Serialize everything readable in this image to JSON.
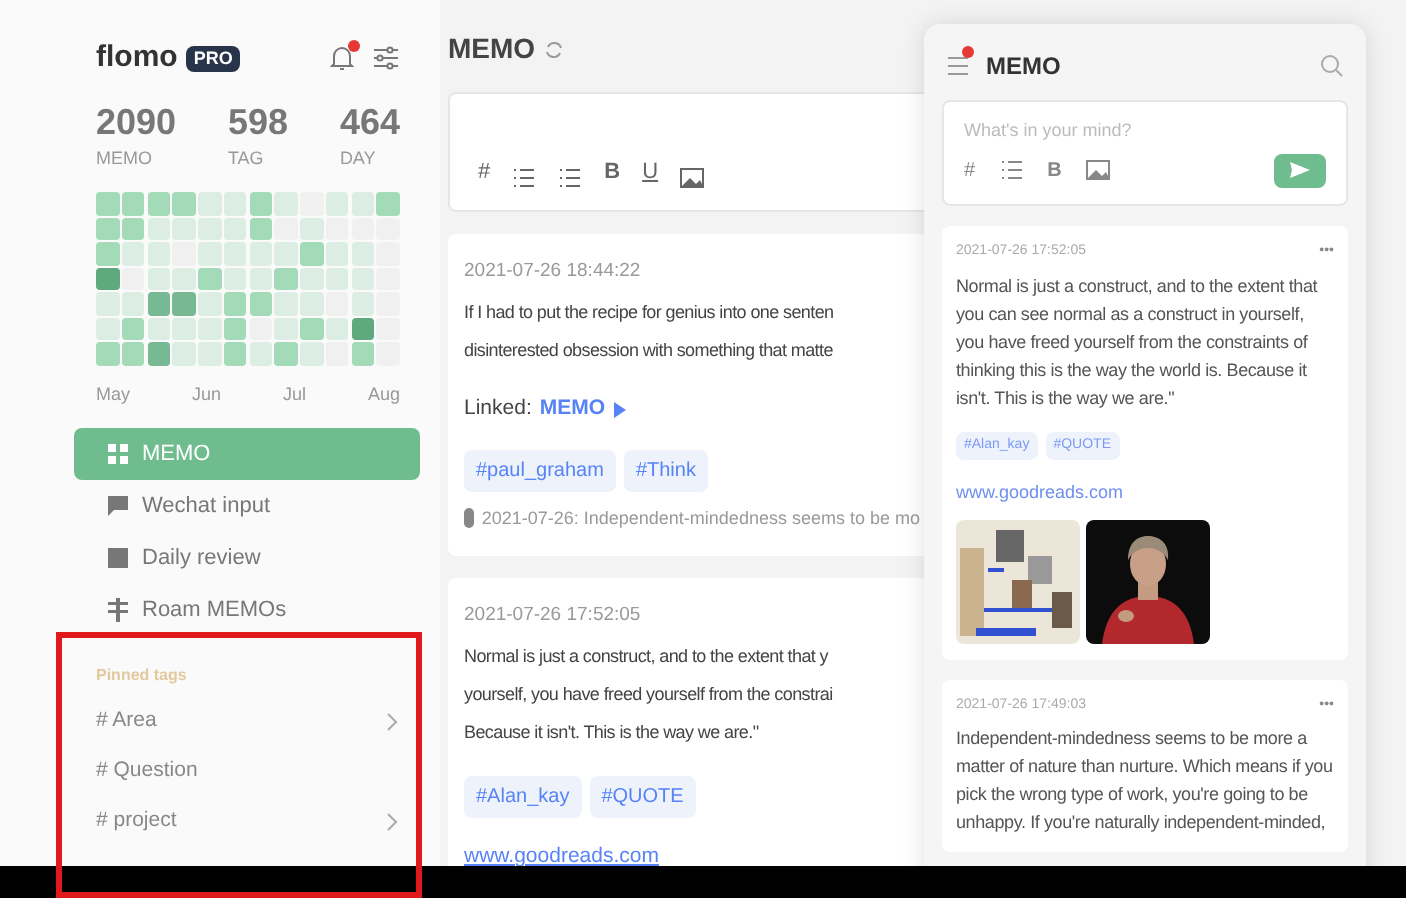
{
  "sidebar": {
    "logo": "flomo",
    "badge": "PRO",
    "notification_dot": true,
    "stats": [
      {
        "value": "2090",
        "label": "MEMO"
      },
      {
        "value": "598",
        "label": "TAG"
      },
      {
        "value": "464",
        "label": "DAY"
      }
    ],
    "heatmap": {
      "rows": [
        [
          {
            "color": "#a3dbb8"
          },
          {
            "color": "#a3dbb8"
          },
          {
            "color": "#a3dbb8"
          },
          {
            "color": "#a3dbb8"
          },
          {
            "color": "#dceee3"
          },
          {
            "color": "#dceee3"
          },
          {
            "color": "#a3dbb8"
          },
          {
            "color": "#dceee3"
          },
          {
            "color": "#f0f0f0"
          },
          {
            "color": "#dceee3"
          },
          {
            "color": "#dceee3"
          },
          {
            "color": "#a3dbb8"
          }
        ],
        [
          {
            "color": "#a3dbb8"
          },
          {
            "color": "#a3dbb8"
          },
          {
            "color": "#dceee3"
          },
          {
            "color": "#dceee3"
          },
          {
            "color": "#dceee3"
          },
          {
            "color": "#dceee3"
          },
          {
            "color": "#a3dbb8"
          },
          {
            "color": "#f0f0f0"
          },
          {
            "color": "#dceee3"
          },
          {
            "color": "#f0f0f0"
          },
          {
            "color": "#f0f0f0"
          },
          {
            "color": "#f0f0f0"
          }
        ],
        [
          {
            "color": "#a3dbb8"
          },
          {
            "color": "#dceee3"
          },
          {
            "color": "#dceee3"
          },
          {
            "color": "#f0f0f0"
          },
          {
            "color": "#dceee3"
          },
          {
            "color": "#dceee3"
          },
          {
            "color": "#dceee3"
          },
          {
            "color": "#dceee3"
          },
          {
            "color": "#a3dbb8"
          },
          {
            "color": "#dceee3"
          },
          {
            "color": "#dceee3"
          },
          {
            "color": "#f0f0f0"
          }
        ],
        [
          {
            "color": "#5fa97e"
          },
          {
            "color": "#f0f0f0"
          },
          {
            "color": "#dceee3"
          },
          {
            "color": "#dceee3"
          },
          {
            "color": "#a3dbb8"
          },
          {
            "color": "#dceee3"
          },
          {
            "color": "#dceee3"
          },
          {
            "color": "#a3dbb8"
          },
          {
            "color": "#dceee3"
          },
          {
            "color": "#dceee3"
          },
          {
            "color": "#dceee3"
          },
          {
            "color": "#f0f0f0"
          }
        ],
        [
          {
            "color": "#dceee3"
          },
          {
            "color": "#dceee3"
          },
          {
            "color": "#76b993"
          },
          {
            "color": "#76b993"
          },
          {
            "color": "#dceee3"
          },
          {
            "color": "#a3dbb8"
          },
          {
            "color": "#a3dbb8"
          },
          {
            "color": "#dceee3"
          },
          {
            "color": "#dceee3"
          },
          {
            "color": "#f0f0f0"
          },
          {
            "color": "#dceee3"
          },
          {
            "color": "#f0f0f0"
          }
        ],
        [
          {
            "color": "#dceee3"
          },
          {
            "color": "#a3dbb8"
          },
          {
            "color": "#dceee3"
          },
          {
            "color": "#dceee3"
          },
          {
            "color": "#dceee3"
          },
          {
            "color": "#a3dbb8"
          },
          {
            "color": "#f0f0f0"
          },
          {
            "color": "#dceee3"
          },
          {
            "color": "#a3dbb8"
          },
          {
            "color": "#dceee3"
          },
          {
            "color": "#5fa97e"
          },
          {
            "color": "#f0f0f0"
          }
        ],
        [
          {
            "color": "#a3dbb8"
          },
          {
            "color": "#a3dbb8"
          },
          {
            "color": "#76b993"
          },
          {
            "color": "#dceee3"
          },
          {
            "color": "#dceee3"
          },
          {
            "color": "#a3dbb8"
          },
          {
            "color": "#dceee3"
          },
          {
            "color": "#a3dbb8"
          },
          {
            "color": "#dceee3"
          },
          {
            "color": "#f0f0f0"
          },
          {
            "color": "#a3dbb8"
          },
          {
            "color": "#f0f0f0"
          }
        ]
      ],
      "months": [
        "May",
        "Jun",
        "Jul",
        "Aug"
      ]
    },
    "nav": [
      {
        "label": "MEMO",
        "kind": "grid",
        "selected": true
      },
      {
        "label": "Wechat input",
        "kind": "chat",
        "selected": false
      },
      {
        "label": "Daily review",
        "kind": "review",
        "selected": false
      },
      {
        "label": "Roam MEMOs",
        "kind": "roam",
        "selected": false
      }
    ],
    "pinned_title": "Pinned tags",
    "pinned_tags": [
      {
        "label": "# Area",
        "has_children": true
      },
      {
        "label": "# Question",
        "has_children": false
      },
      {
        "label": "# project",
        "has_children": true
      }
    ]
  },
  "main": {
    "title": "MEMO",
    "toolbar": [
      "#",
      "B",
      "U"
    ],
    "memos": [
      {
        "time": "2021-07-26 18:44:22",
        "lines": [
          "If I had to put the recipe for genius into one senten",
          "disinterested obsession with something that matte"
        ],
        "linked_label": "Linked:",
        "linked": "MEMO",
        "tags": [
          "#paul_graham",
          "#Think"
        ],
        "backlink": "2021-07-26: Independent-mindedness seems to be mo"
      },
      {
        "time": "2021-07-26 17:52:05",
        "lines": [
          "Normal is just a construct, and to the extent that y",
          "yourself, you have freed yourself from the constrai",
          "Because it isn't. This is the way we are.\""
        ],
        "tags": [
          "#Alan_kay",
          "#QUOTE"
        ],
        "link": "www.goodreads.com"
      }
    ]
  },
  "panel": {
    "title": "MEMO",
    "notification_dot": true,
    "placeholder": "What's in your mind?",
    "toolbar": [
      "#",
      "B"
    ],
    "memos": [
      {
        "time": "2021-07-26 17:52:05",
        "more": "•••",
        "text": "Normal is just a construct, and to the extent that you can see normal as a construct in yourself, you have freed yourself from the constraints of thinking this is the way the world is. Because it isn't. This is the way we are.\"",
        "tags": [
          "#Alan_kay",
          "#QUOTE"
        ],
        "link": "www.goodreads.com",
        "images": [
          {
            "kind": "picture"
          },
          {
            "kind": "picture"
          }
        ]
      },
      {
        "time": "2021-07-26 17:49:03",
        "more": "•••",
        "text": "Independent-mindedness seems to be more a matter of nature than nurture. Which means if you pick the wrong type of work, you're going to be unhappy. If you're naturally independent-minded,"
      }
    ]
  }
}
